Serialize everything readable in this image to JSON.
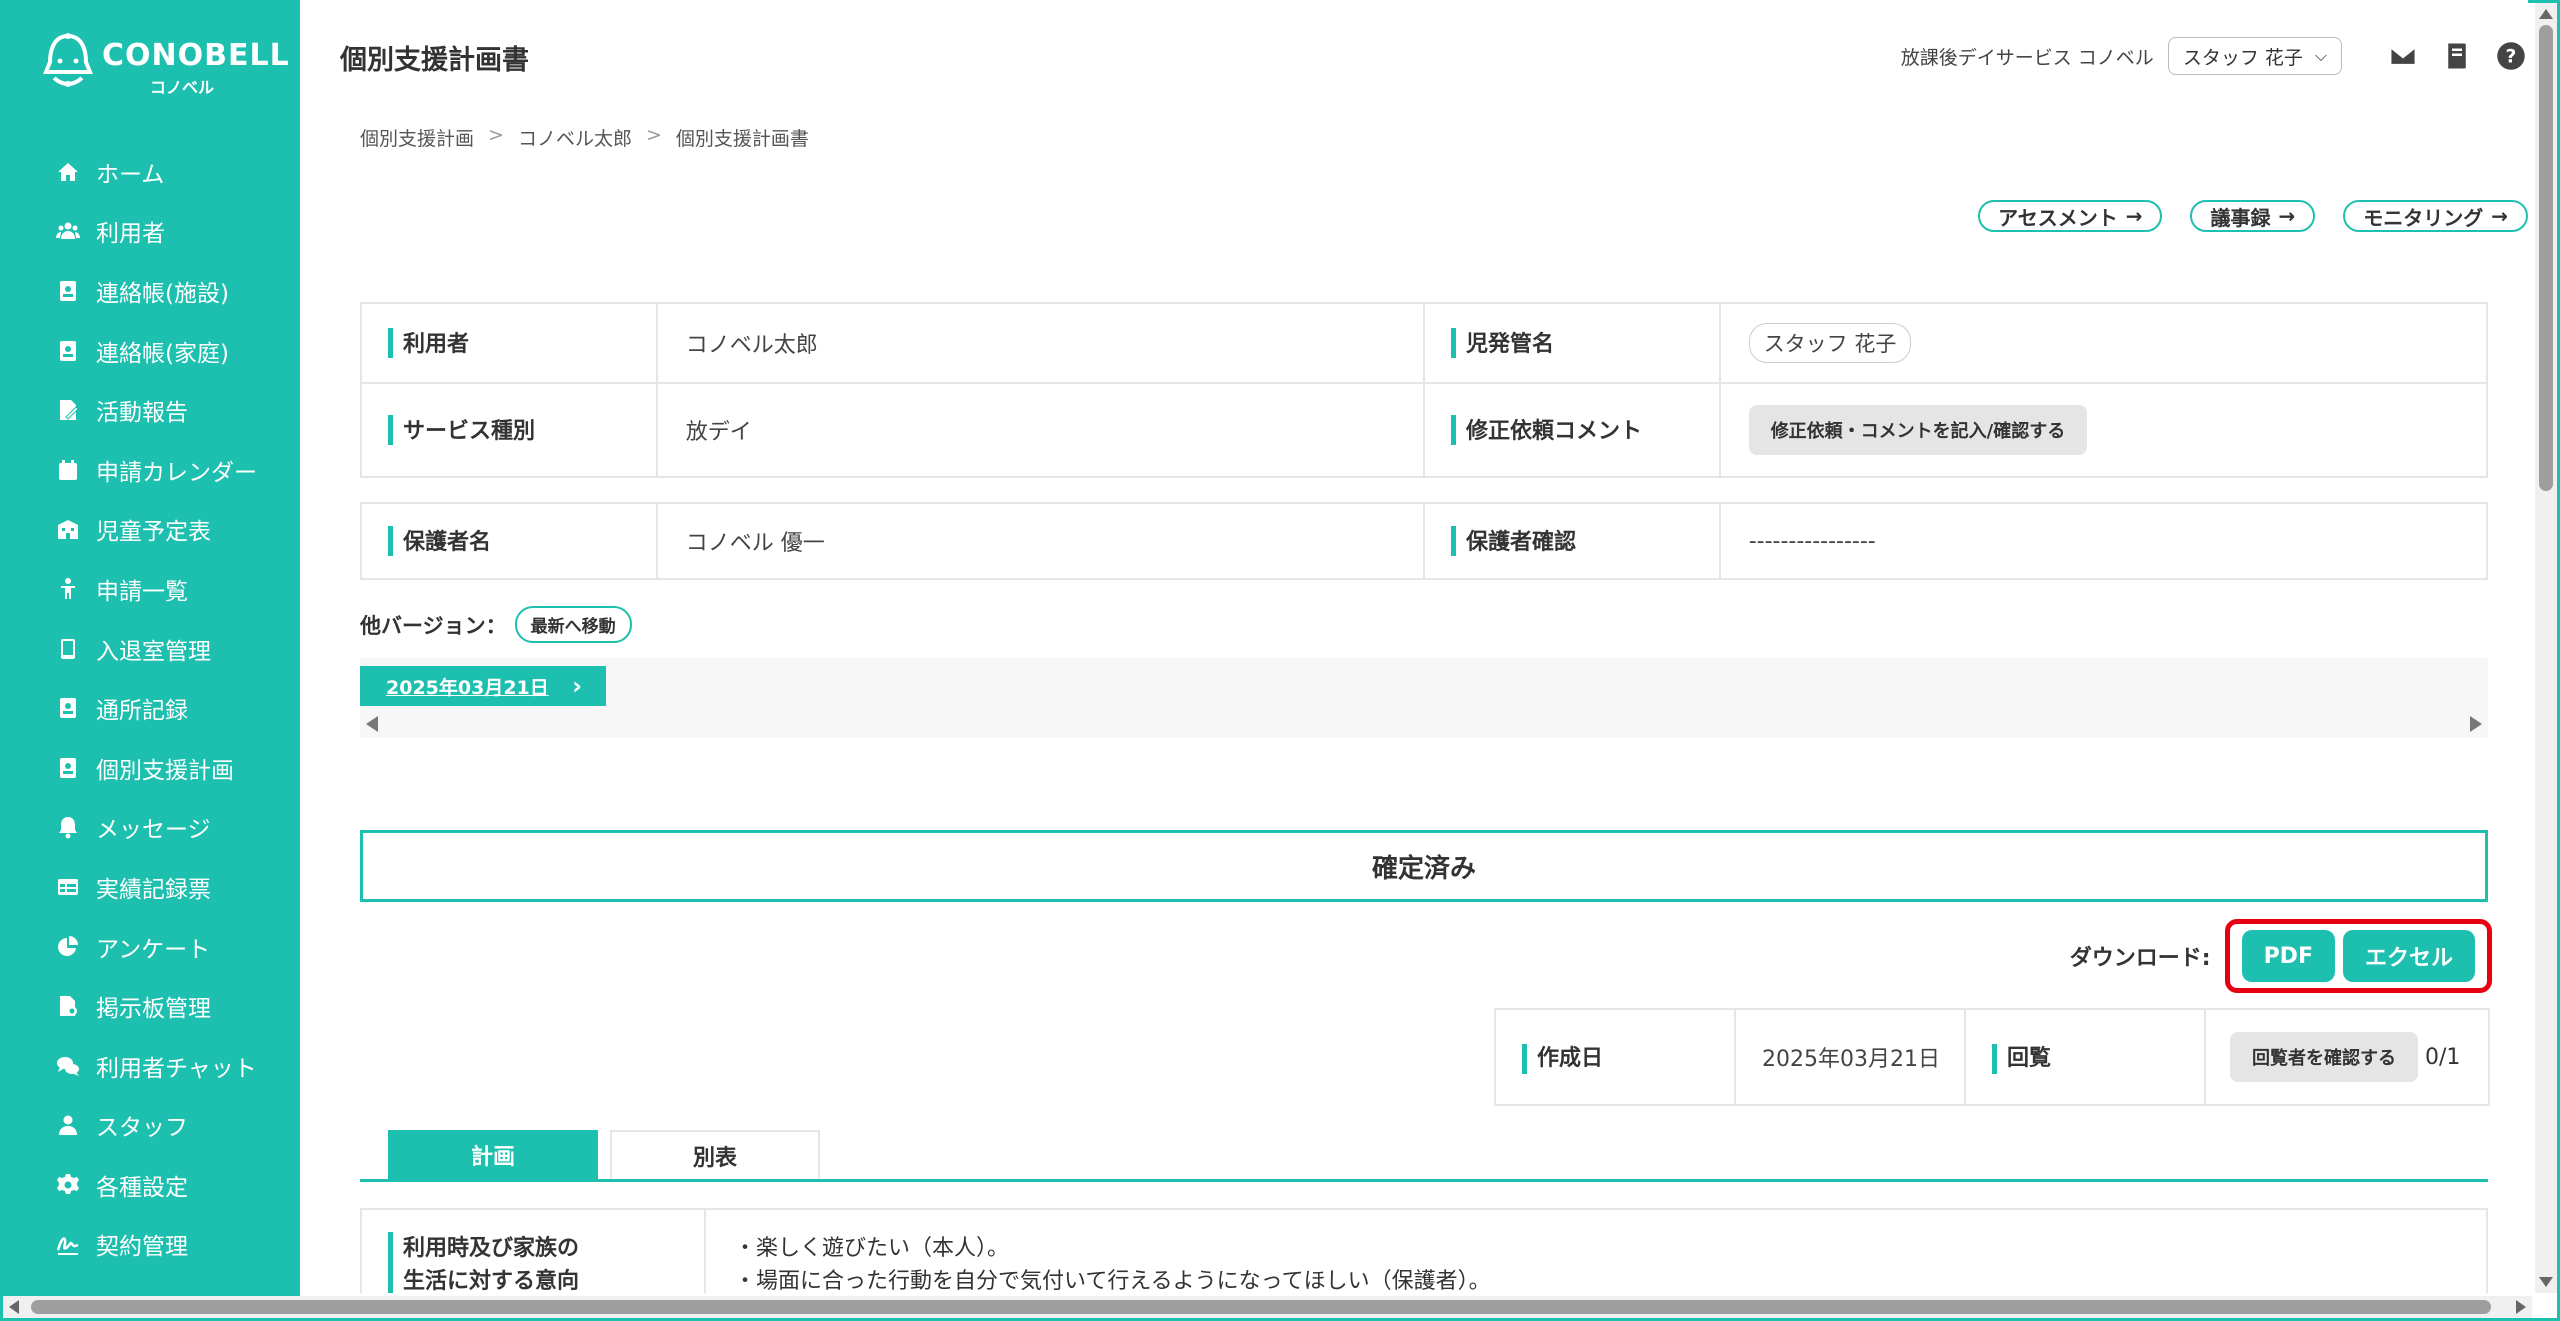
{
  "brand": {
    "name": "CONOBELL",
    "sub": "コノベル"
  },
  "sidebar": {
    "items": [
      {
        "label": "ホーム",
        "icon": "home-icon"
      },
      {
        "label": "利用者",
        "icon": "users-icon"
      },
      {
        "label": "連絡帳(施設)",
        "icon": "contact-book-icon"
      },
      {
        "label": "連絡帳(家庭)",
        "icon": "contact-book-icon"
      },
      {
        "label": "活動報告",
        "icon": "report-icon"
      },
      {
        "label": "申請カレンダー",
        "icon": "calendar-icon"
      },
      {
        "label": "児童予定表",
        "icon": "building-icon"
      },
      {
        "label": "申請一覧",
        "icon": "child-icon"
      },
      {
        "label": "入退室管理",
        "icon": "tablet-icon"
      },
      {
        "label": "通所記録",
        "icon": "contact-book-icon"
      },
      {
        "label": "個別支援計画",
        "icon": "contact-book-icon"
      },
      {
        "label": "メッセージ",
        "icon": "bell-icon"
      },
      {
        "label": "実績記録票",
        "icon": "table-icon"
      },
      {
        "label": "アンケート",
        "icon": "pie-chart-icon"
      },
      {
        "label": "掲示板管理",
        "icon": "file-gear-icon"
      },
      {
        "label": "利用者チャット",
        "icon": "chat-icon"
      },
      {
        "label": "スタッフ",
        "icon": "user-icon"
      },
      {
        "label": "各種設定",
        "icon": "gear-icon"
      },
      {
        "label": "契約管理",
        "icon": "signature-icon"
      }
    ]
  },
  "header": {
    "title": "個別支援計画書",
    "facility": "放課後デイサービス コノベル",
    "staff": "スタッフ 花子"
  },
  "breadcrumb": [
    "個別支援計画",
    "コノベル太郎",
    "個別支援計画書"
  ],
  "links": [
    "アセスメント",
    "議事録",
    "モニタリング"
  ],
  "info": {
    "user_label": "利用者",
    "user_value": "コノベル太郎",
    "manager_label": "児発管名",
    "manager_value": "スタッフ 花子",
    "service_label": "サービス種別",
    "service_value": "放デイ",
    "comment_label": "修正依頼コメント",
    "comment_button": "修正依頼・コメントを記入/確認する",
    "guardian_label": "保護者名",
    "guardian_value": "コノベル 優一",
    "guardian_confirm_label": "保護者確認",
    "guardian_confirm_value": "----------------"
  },
  "versions": {
    "label": "他バージョン：",
    "latest_button": "最新へ移動",
    "current": "2025年03月21日"
  },
  "status": "確定済み",
  "download": {
    "label": "ダウンロード:",
    "pdf": "PDF",
    "excel": "エクセル"
  },
  "meta": {
    "created_label": "作成日",
    "created_value": "2025年03月21日",
    "circulation_label": "回覧",
    "circulation_button": "回覧者を確認する",
    "circulation_count": "0/1"
  },
  "tabs": [
    "計画",
    "別表"
  ],
  "plan": {
    "label_line1": "利用時及び家族の",
    "label_line2": "生活に対する意向",
    "line1": "・楽しく遊びたい（本人）。",
    "line2": "・場面に合った行動を自分で気付いて行えるようになってほしい（保護者）。"
  },
  "colors": {
    "accent": "#1dbfaf",
    "highlight": "#e60012"
  }
}
